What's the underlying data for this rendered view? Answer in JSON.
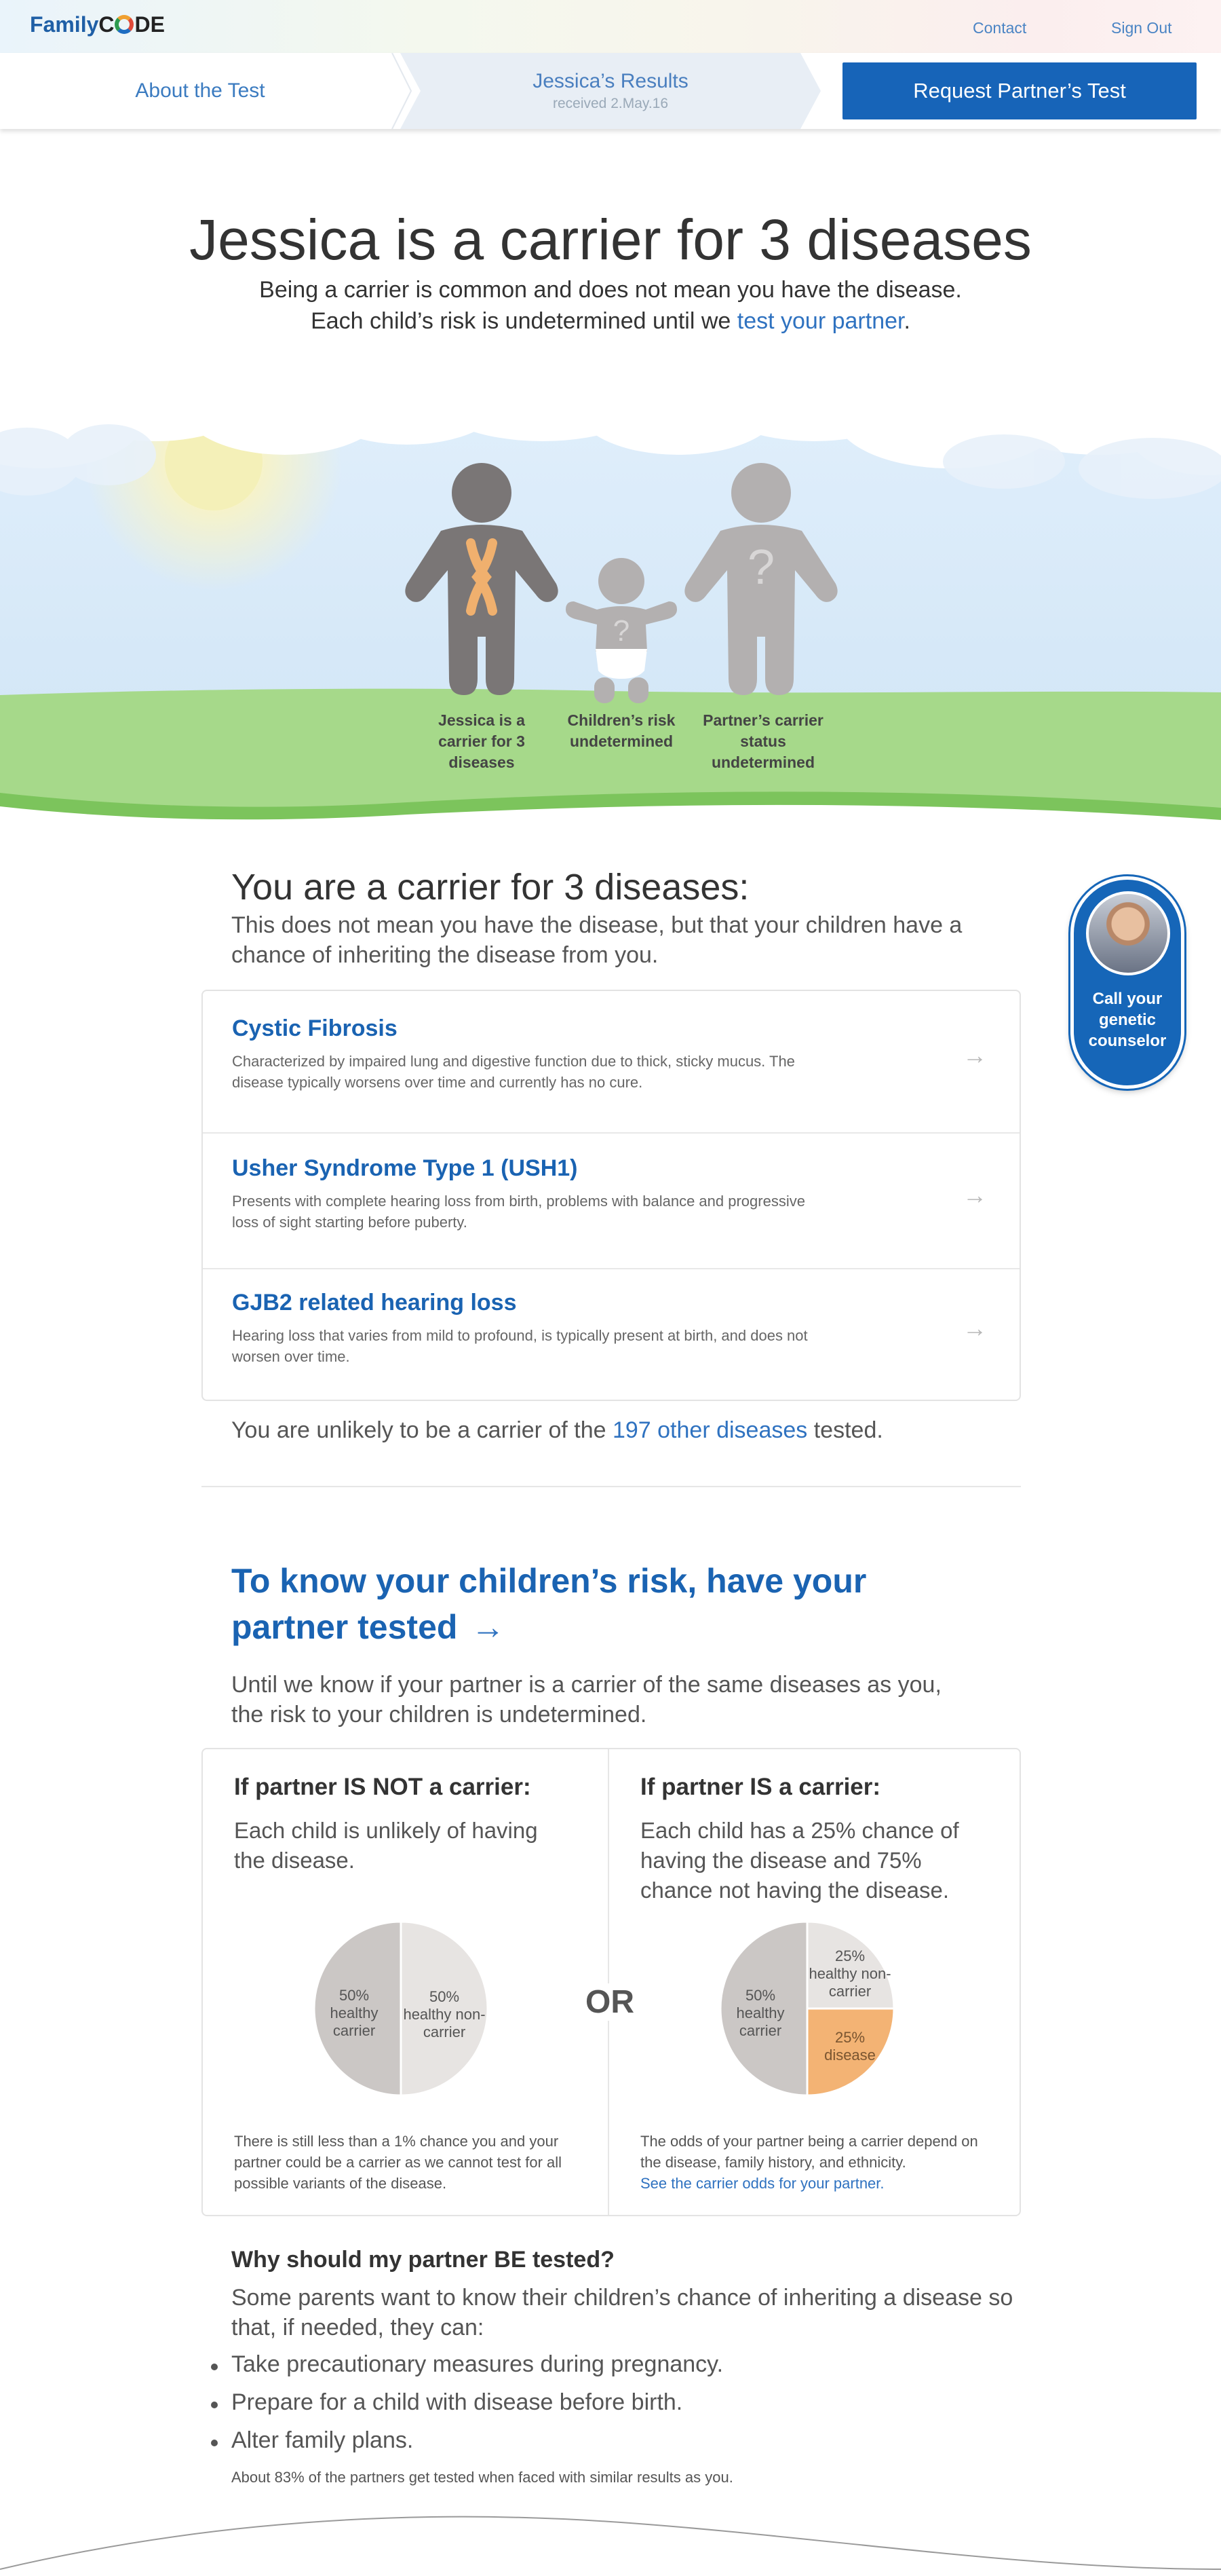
{
  "header": {
    "logo_family": "Family",
    "logo_c": "C",
    "logo_de": "DE",
    "contact": "Contact",
    "signout": "Sign Out"
  },
  "nav": {
    "about": "About the Test",
    "results_title": "Jessica’s Results",
    "results_sub": "received 2.May.16",
    "request_button": "Request Partner’s Test"
  },
  "hero": {
    "title": "Jessica is a carrier for 3 diseases",
    "line1": "Being a carrier is common and does not mean you have the disease.",
    "line2_prefix": "Each child’s risk is undetermined until we ",
    "line2_link": "test your partner",
    "line2_suffix": "."
  },
  "illustration": {
    "labels": [
      "Jessica is a carrier for 3 diseases",
      "Children’s risk undetermined",
      "Partner’s carrier status undetermined"
    ],
    "unknown_mark": "?"
  },
  "carrier": {
    "title": "You are a carrier for 3 diseases:",
    "desc": "This does not mean you have the disease, but that your children have a chance of inheriting the disease from you.",
    "diseases": [
      {
        "name": "Cystic Fibrosis",
        "desc": "Characterized by impaired lung and digestive function due to thick, sticky mucus. The disease typically worsens over time and currently has no cure."
      },
      {
        "name": "Usher Syndrome Type 1 (USH1)",
        "desc": "Presents with complete hearing loss from birth, problems with balance and progressive loss of sight starting before puberty."
      },
      {
        "name": "GJB2 related hearing loss",
        "desc": "Hearing loss that varies from mild to profound, is typically present at birth, and does not worsen over time."
      }
    ],
    "arrow": "→",
    "unlikely_prefix": "You are unlikely to be a carrier of the ",
    "unlikely_link": "197 other diseases",
    "unlikely_suffix": " tested."
  },
  "counselor": {
    "label": "Call your genetic counselor"
  },
  "partner": {
    "title": "To know your children’s risk, have your partner tested",
    "arrow": "→",
    "desc": "Until we know if your partner is a carrier of the same diseases as you, the risk to your children is undetermined.",
    "or": "OR",
    "not_carrier": {
      "heading": "If partner IS NOT a carrier:",
      "text": "Each child is unlikely of having the disease.",
      "slices": [
        {
          "pct": "50%",
          "label": "healthy carrier",
          "value": 50,
          "color": "#cbc7c5"
        },
        {
          "pct": "50%",
          "label": "healthy non-carrier",
          "value": 50,
          "color": "#e7e4e2"
        }
      ],
      "footnote": "There is still less than a 1% chance you and your partner could be a carrier as we cannot test for all possible variants of the disease."
    },
    "is_carrier": {
      "heading": "If partner IS a carrier:",
      "text": "Each child has a 25% chance of having the disease and 75% chance not having the disease.",
      "slices": [
        {
          "pct": "50%",
          "label": "healthy carrier",
          "value": 50,
          "color": "#cbc7c5"
        },
        {
          "pct": "25%",
          "label": "healthy non-carrier",
          "value": 25,
          "color": "#e7e4e2"
        },
        {
          "pct": "25%",
          "label": "disease",
          "value": 25,
          "color": "#f3b374"
        }
      ],
      "footnote": "The odds of your partner being a carrier depend on the disease, family history, and ethnicity.",
      "footnote_link": "See the carrier odds for your partner."
    }
  },
  "why": {
    "heading": "Why should my partner BE tested?",
    "desc": "Some parents want to know their children’s chance of inheriting a disease so that, if needed, they can:",
    "items": [
      "Take precautionary measures during pregnancy.",
      "Prepare for a child with disease before birth.",
      "Alter family plans."
    ],
    "note": "About 83% of the partners get tested when faced with similar results as you."
  }
}
